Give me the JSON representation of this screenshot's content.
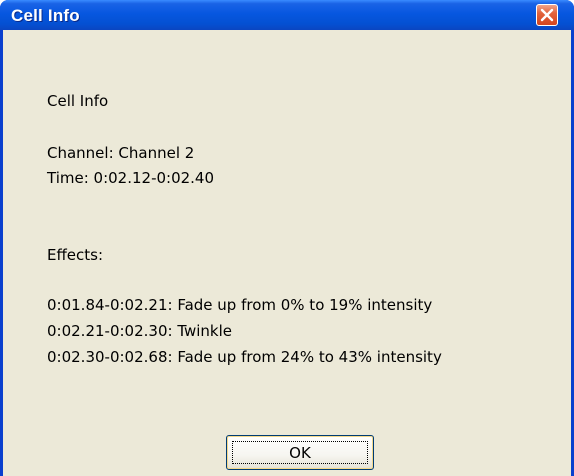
{
  "window": {
    "title": "Cell Info",
    "close_icon": "close-x-icon"
  },
  "content": {
    "heading": "Cell Info",
    "channel": "Channel: Channel 2",
    "time": "Time: 0:02.12-0:02.40",
    "effects_label": "Effects:",
    "effects": [
      "0:01.84-0:02.21: Fade up from 0% to 19% intensity",
      "0:02.21-0:02.30: Twinkle",
      "0:02.30-0:02.68: Fade up from 24% to 43% intensity"
    ]
  },
  "buttons": {
    "ok_label": "OK"
  }
}
